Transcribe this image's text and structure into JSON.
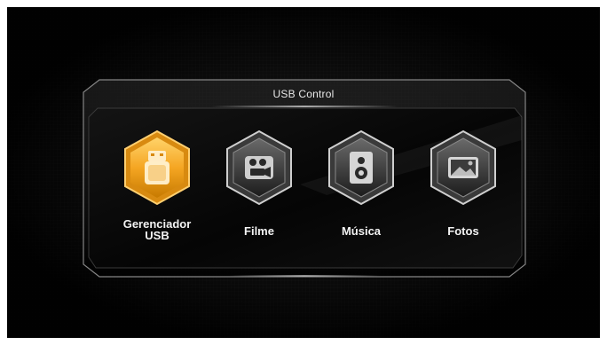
{
  "panel": {
    "title": "USB Control"
  },
  "menu": {
    "items": [
      {
        "label": "Gerenciador\nUSB",
        "icon": "usb-drive-icon",
        "selected": true
      },
      {
        "label": "Filme",
        "icon": "movie-camera-icon",
        "selected": false
      },
      {
        "label": "Música",
        "icon": "speaker-icon",
        "selected": false
      },
      {
        "label": "Fotos",
        "icon": "photo-icon",
        "selected": false
      }
    ]
  },
  "colors": {
    "background": "#0b0b0b",
    "selected_accent": "#f5a623",
    "text": "#f2f2f2",
    "panel_border": "#9a9a9a"
  }
}
